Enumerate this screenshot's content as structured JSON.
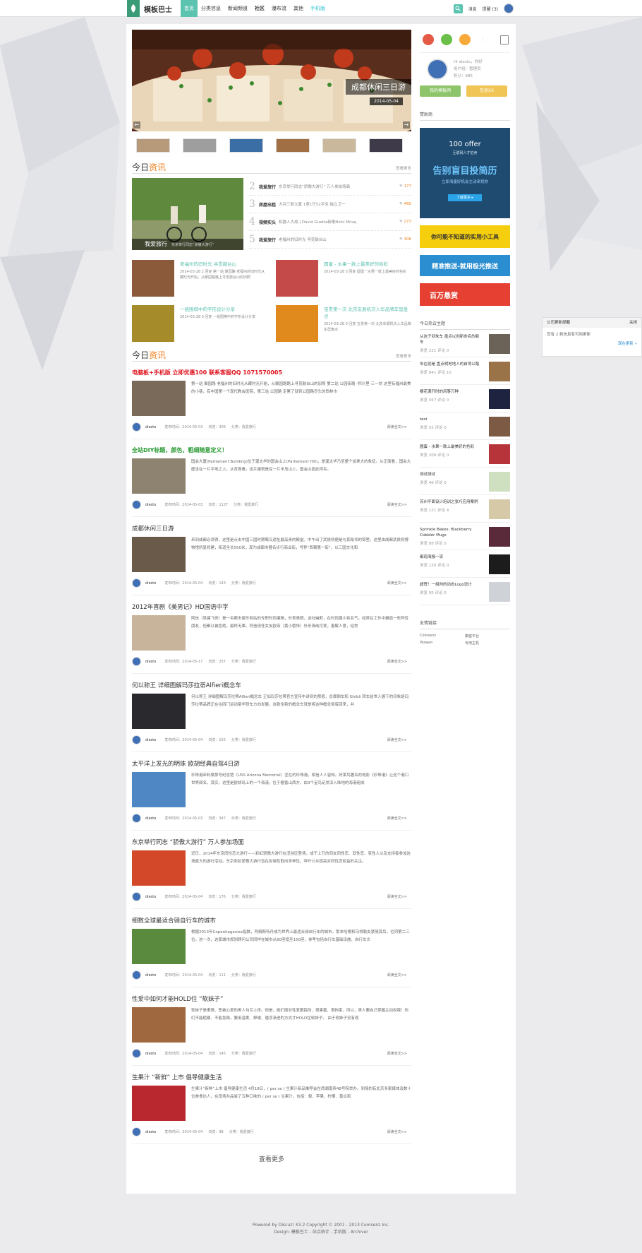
{
  "nav": {
    "logo": "模板巴士",
    "items": [
      "首页",
      "分类信息",
      "新闻频道",
      "社区",
      "瀑布流",
      "其他",
      "手机版"
    ],
    "messages": "消息",
    "reminders": "提醒 (3)"
  },
  "slider": {
    "caption": "成都休闲三日游",
    "date": "2014-05-04"
  },
  "news": {
    "head_a": "今日",
    "head_b": "资讯",
    "more": "查看更多",
    "hero_caption": "我爱旅行",
    "hero_sub": "东京举行同志“骄傲大游行”",
    "hot": [
      {
        "num": "2",
        "tag": "我爱旅行",
        "desc": "东京举行同志“骄傲大游行” 万人参加场面",
        "count": "177"
      },
      {
        "num": "3",
        "tag": "房屋出租",
        "desc": "大兵三和大厦 1室1厅52平米 独立卫一",
        "count": "460"
      },
      {
        "num": "4",
        "tag": "视频实头",
        "desc": "机器人大战 | David Guetta新歌Nicki Minaj",
        "count": "273"
      },
      {
        "num": "5",
        "tag": "我爱旅行",
        "desc": "老福州的旧时光 寻觅鼓台山",
        "count": "306"
      }
    ],
    "grid": [
      {
        "title": "老福州的旧时光 寻觅鼓台山",
        "desc": "2014-03-28 2 回复  第一站 聚园路 老福州的旧时光从藏时光开始，从聚园路路上寻觅鼓台山的旧照"
      },
      {
        "title": "圆蛋 - 水果一款上最美好的色彩",
        "desc": "2014-03-28 3 回复  圆蛋一水果一款上最美好的色彩"
      },
      {
        "title": "一组围棋中的字形设计分享",
        "desc": "2014-03-28 0 回复  一组围棋中的字形设计分享"
      },
      {
        "title": "宝贵第一次 北京友展机次入华品牌车型盘点",
        "desc": "2014-03-28 0 回复  宝贵第一次 北京车展机次入华品牌车型盘点"
      }
    ]
  },
  "feed": {
    "head_a": "今日",
    "head_b": "资讯",
    "more": "查看更多",
    "promo1": "电脑板+手机版 立即优惠100 联系客服QQ 1071570005",
    "promo2": "全站DIY标题，颜色，粗细随意定义！",
    "posts": [
      {
        "title": "",
        "text": "第一站 聚园路 老福州的旧时光从藏时光开始，从聚园路路上寻觅鼓台山的旧照 第二站 公园街路 -积兴里-三一坊 这里有福州最美的小巷，有中国第一个现代教会医院，第三站 公园路 走累了就到公园路尽头的西林巾",
        "author": "diesto",
        "date": "发布时间：2014-05-03",
        "views": "浏览：306",
        "cat": "分类：我爱旅行",
        "read": "阅读全文>>"
      },
      {
        "title": "",
        "text": "国会大厦(Parliament Building)位于渥太华的国会山上(Parliament Hill)，是渥太华乃至整个加拿大的象征。从正面看，国会大厦坐在一片平地之上，从背面看，这片建筑是在一片半岛山上，国会山因此得名。",
        "author": "diesto",
        "date": "发布时间：2014-05-03",
        "views": "浏览：1127",
        "cat": "分类：我爱旅行",
        "read": "阅读全文>>"
      },
      {
        "title": "成都休闲三日游",
        "text": "来到成都必须得，这里是点击中国三国时期蜀汉遗址最高贵的殿堂。中午出了武侯祠便是与其毗邻的锦里，这里由成都武侯祠博物馆所复修建，街道全长550米，现为成都市著名步行商业街，号称“西蜀第一街”，以三国文化和",
        "author": "diesto",
        "date": "发布时间：2014-05-04",
        "views": "浏览：143",
        "cat": "分类：我爱旅行",
        "read": "阅读全文>>"
      },
      {
        "title": "2012年喜剧《美男记》HD国语中字",
        "text": "阿信（吴建飞饰）是一名都市娱乐网站的专职时尚编辑，外表美貌，谈吐幽默，在时尚圈小有名气，经常在工作中邂逅一些异性朋友，但都以被拒绝，最终无果。阿信现任女友欧菲（黄小蕾饰）外形清纯可爱，善解人意，经常",
        "author": "diesto",
        "date": "发布时间：2014-05-17",
        "views": "浏览：257",
        "cat": "分类：我爱旅行",
        "read": "阅读全文>>"
      },
      {
        "title": "何以称王 详细图解玛莎拉蒂Alfieri概念车",
        "text": "何以称王 详细图解玛莎拉蒂Alfieri概念车 正如玛莎拉蒂官方宣传中讲到的那般，总裁钢车和 Ghibli 轿车给世人展下的印象是玛莎拉蒂品牌正在往四门运动豪华轿车方向发展，这款全新的概念车就是将这种概念彻底回来，并",
        "author": "diesto",
        "date": "发布时间：2014-05-04",
        "views": "浏览：155",
        "cat": "分类：我爱旅行",
        "read": "阅读全文>>"
      },
      {
        "title": "太平洋上发光的明珠 欧胡经典自驾4日游",
        "text": "珍珠港亚利桑那号纪念馆（USS Arizona Memorial）坐在的珍珠港，相信人人皆知。好莱坞著名的电影《珍珠港》让这个港口世界闻名。其实，这里是欧胡岛上的一个海港，位于檀香山西方，由3个呈鸟足状深入陆地的海港组成",
        "author": "diesto",
        "date": "发布时间：2014-05-03",
        "views": "浏览：347",
        "cat": "分类：我爱旅行",
        "read": "阅读全文>>"
      },
      {
        "title": "东京举行同志 “骄傲大游行” 万人参加场面",
        "text": "近日，2014年东京同性恋大游行——彩虹骄傲大游行在涩谷区登场，成千上万的同女同性恋、双性恋、变性人以及支持者参加这场盛大的游行活动。东京彩虹骄傲大游行旨在反映性取向多样性，呼吁公众提高对同性恋权益的关注。",
        "author": "diesto",
        "date": "发布时间：2014-05-04",
        "views": "浏览：176",
        "cat": "分类：我爱旅行",
        "read": "阅读全文>>"
      },
      {
        "title": "细数全球最适合骑自行车的城市",
        "text": "根据2013年Copenhagenize指数，阿姆斯特丹成为世界上最适合骑自行车的城市，那本哈根和乌得勒支紧随其后，位列第二三位。这一次，这家城市规划顾问公司同样在城市从80座增至150座，参考包括自行车基础设施、自行车文",
        "author": "diesto",
        "date": "发布时间：2014-05-04",
        "views": "浏览：111",
        "cat": "分类：我爱旅行",
        "read": "阅读全文>>"
      },
      {
        "title": "性爱中如何才能HOLD住 “软妹子”",
        "text": "软妹子是柔情、恶被心爱的男人勾引上床。但是，她们面对性爱跟踪的、很害羞、很拘束，所以，男人要自己掌握主动权哦！你们不能粗暴、不能急躁，要用温柔、舒缓、循序渐进的方式才HOLD住软妹子。 由于软妹子没有观",
        "author": "diesto",
        "date": "发布时间：2014-05-04",
        "views": "浏览：145",
        "cat": "分类：我爱旅行",
        "read": "阅读全文>>"
      },
      {
        "title": "生果汁 “新鲜” 上市 倡导健康生活",
        "text": "生果汁“新鲜”上市 倡导健康生活 4月18日，( per se ) 生果汁新品推荐会在西湖南宾48号院举办。到场的有北京多家媒体及数十位美食达人，在现场共品尝了五种口味的 ( per se ) 生果汁，包括：梨、苹果、柠檬、黄瓜和",
        "author": "diesto",
        "date": "发布时间：2014-05-04",
        "views": "浏览：98",
        "cat": "分类：我爱旅行",
        "read": "阅读全文>>"
      }
    ],
    "loadmore": "查看更多"
  },
  "side": {
    "greeting": "Hi diesto，你好",
    "group": "用户组：管理员",
    "points": "积分：685",
    "btn1": "我的模板网",
    "btn2": "签退XX",
    "sponsor": "赞助商",
    "ad1_brand": "100 offer",
    "ad1_sub": "互联网人才拍卖",
    "ad1_big": "告别盲目投简历",
    "ad1_small": "立即海量好机会主动来找你",
    "ad1_btn": "了解更多 ▸",
    "ad2": "你可能不知道的实用小工具",
    "ad3": "精准推送-就用极光推送",
    "ad4": "百万悬赏",
    "topics_head": "今日热议主题",
    "topics": [
      {
        "title": "从这子到朱车 盘点以创新命名的新车",
        "meta": "浏览 221  评论 0"
      },
      {
        "title": "车在就是 盘点明地地人的自驾公路",
        "meta": "浏览 841  评论 10"
      },
      {
        "title": "樱花满开时的风筝万种",
        "meta": "浏览 457  评论 0"
      },
      {
        "title": "test",
        "meta": "浏览 55  评论 0"
      },
      {
        "title": "圆蛋 - 水果一款上最美好的色彩",
        "meta": "浏览 209  评论 0"
      },
      {
        "title": "测试测试",
        "meta": "浏览 46  评论 0"
      },
      {
        "title": "苏州平面设计培训之张巧应用案例",
        "meta": "浏览 121  评论 4"
      },
      {
        "title": "Sprinkle Bakes: Blackberry Cobbler Mugs",
        "meta": "浏览 88  评论 0"
      },
      {
        "title": "都现海报一流",
        "meta": "浏览 130  评论 0"
      },
      {
        "title": "超赞！一组帅的动态Logo设计",
        "meta": "浏览 95  评论 0"
      }
    ],
    "links_head": "友情链接",
    "links": [
      "Comsenz",
      "康盛平台",
      "Yeswan",
      "专用主机"
    ]
  },
  "remind": {
    "title": "公司更新提醒",
    "close": "关闭",
    "body": "您有 2 新信息有可用更新",
    "link": "现在更新 »"
  },
  "footer": {
    "line1": "Powered by Discuz! X3.2 Copyright © 2001 - 2013 Comsenz Inc.",
    "line2": "Design: 模板巴士 - 站点统计 - 手机版 - Archiver"
  }
}
